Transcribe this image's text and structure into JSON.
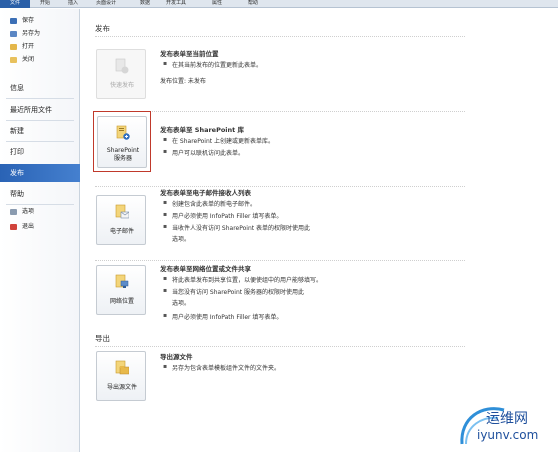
{
  "ribbon": {
    "tabs": [
      "文件",
      "开始",
      "插入",
      "页面设计",
      "数据",
      "开发工具",
      "属性",
      "帮助"
    ]
  },
  "sidebar": {
    "small_items": [
      {
        "label": "保存",
        "icon": "save-icon"
      },
      {
        "label": "另存为",
        "icon": "save-as-icon"
      },
      {
        "label": "打开",
        "icon": "open-folder-icon"
      },
      {
        "label": "关闭",
        "icon": "close-folder-icon"
      }
    ],
    "big_items": [
      {
        "label": "信息"
      },
      {
        "label": "最近所用文件"
      },
      {
        "label": "新建"
      },
      {
        "label": "打印"
      },
      {
        "label": "发布"
      },
      {
        "label": "帮助"
      }
    ],
    "bottom_items": [
      {
        "label": "选项",
        "icon": "options-icon"
      },
      {
        "label": "退出",
        "icon": "exit-icon"
      }
    ]
  },
  "main": {
    "publish_heading": "发布",
    "export_heading": "导出",
    "quick_publish": {
      "button": "快速发布",
      "title": "发布表单至当前位置",
      "bullets": [
        "在其当前发布的位置更新此表单。"
      ],
      "location_label": "发布位置: 未发布"
    },
    "sharepoint": {
      "button_line1": "SharePoint",
      "button_line2": "服务器",
      "title": "发布表单至 SharePoint 库",
      "bullets": [
        "在 SharePoint 上创建或更新表单库。",
        "用户可以联机访问此表单。"
      ]
    },
    "email": {
      "button": "电子邮件",
      "title": "发布表单至电子邮件接收人列表",
      "bullets": [
        "创建包含此表单的新电子邮件。",
        "用户必须使用 InfoPath Filler 填写表单。",
        "当收件人没有访问 SharePoint 表单的权限时使用此"
      ],
      "continuation": "选项。"
    },
    "network": {
      "button": "网络位置",
      "title": "发布表单至网络位置或文件共享",
      "bullets": [
        "将此表单发布到共享位置，以便使组中的用户能够填写。",
        "当您没有访问 SharePoint 服务器的权限时使用此"
      ],
      "continuation": "选项。",
      "bullets2": [
        "用户必须使用 InfoPath Filler 填写表单。"
      ]
    },
    "export_source": {
      "button": "导出源文件",
      "title": "导出源文件",
      "bullets": [
        "另存为包含表单模板组件文件的文件夹。"
      ]
    }
  },
  "watermark": {
    "name": "运维网",
    "url": "iyunv.com"
  }
}
